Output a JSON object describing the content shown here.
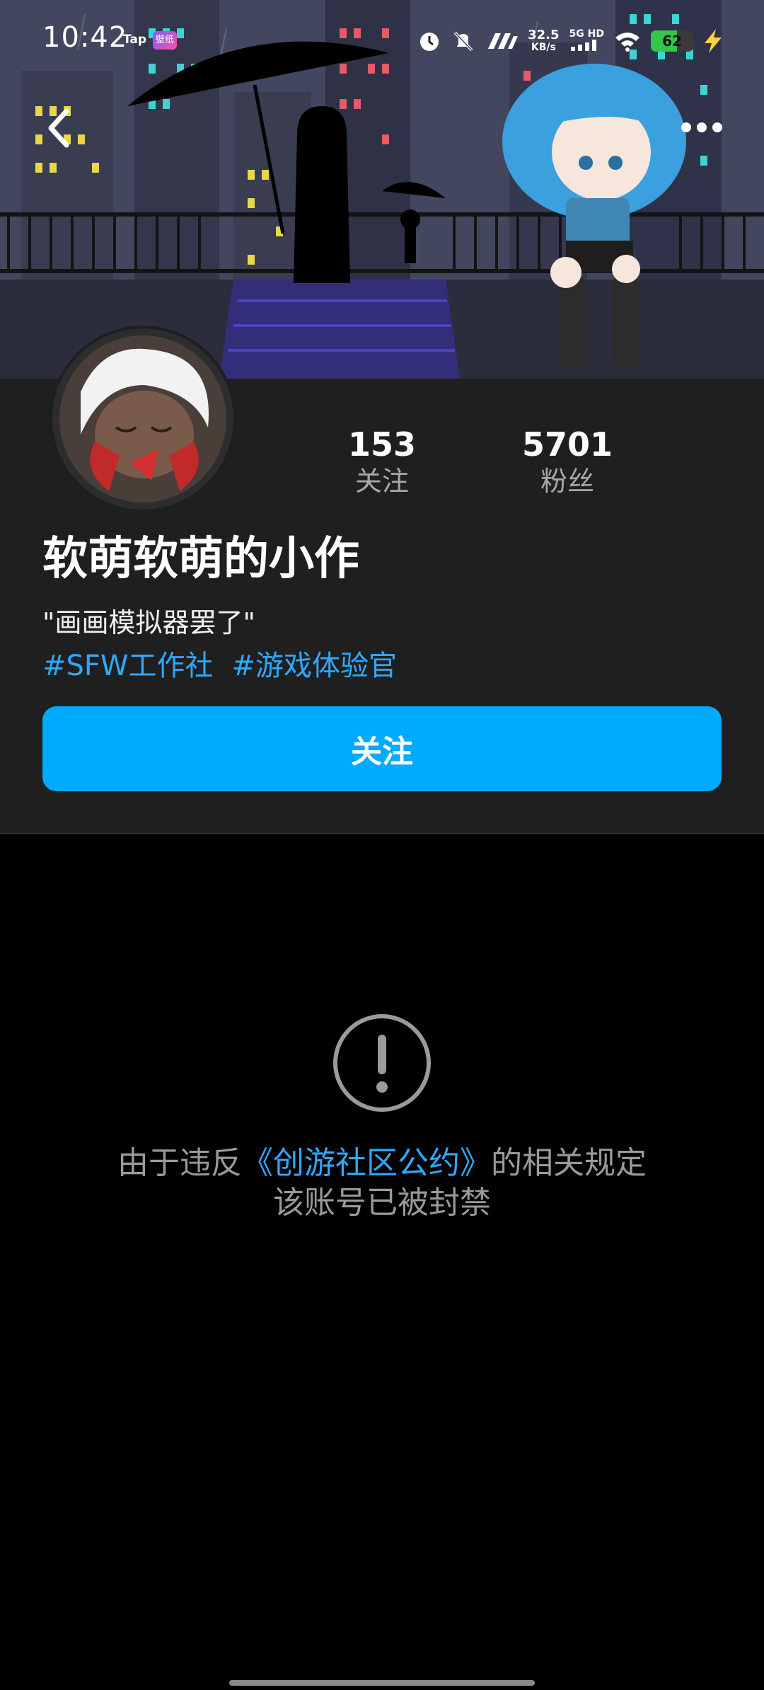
{
  "status_bar": {
    "time": "10:42",
    "app_label": "Tap",
    "wallpaper_label": "壁纸",
    "speed_value": "32.5",
    "speed_unit": "KB/s",
    "network": "5G HD",
    "battery_percent": 62,
    "battery_text": "62",
    "icons": [
      "alarm-icon",
      "mute-bell-icon",
      "signal-icon",
      "wifi-icon",
      "charging-icon"
    ]
  },
  "nav": {
    "back_icon": "chevron-left-icon",
    "more_icon": "more-dots-icon"
  },
  "profile": {
    "following_count": "153",
    "following_label": "关注",
    "followers_count": "5701",
    "followers_label": "粉丝",
    "name": "软萌软萌的小作",
    "bio": "\"画画模拟器罢了\"",
    "tags": [
      "#SFW工作社",
      "#游戏体验官"
    ],
    "follow_button": "关注"
  },
  "notice": {
    "icon": "exclamation-circle-icon",
    "prefix": "由于违反",
    "link": "《创游社区公约》",
    "suffix": "的相关规定",
    "line2": "该账号已被封禁"
  },
  "colors": {
    "accent": "#00aaff",
    "link": "#2fa8ff",
    "panel": "#1f1f1f",
    "background": "#000000"
  }
}
